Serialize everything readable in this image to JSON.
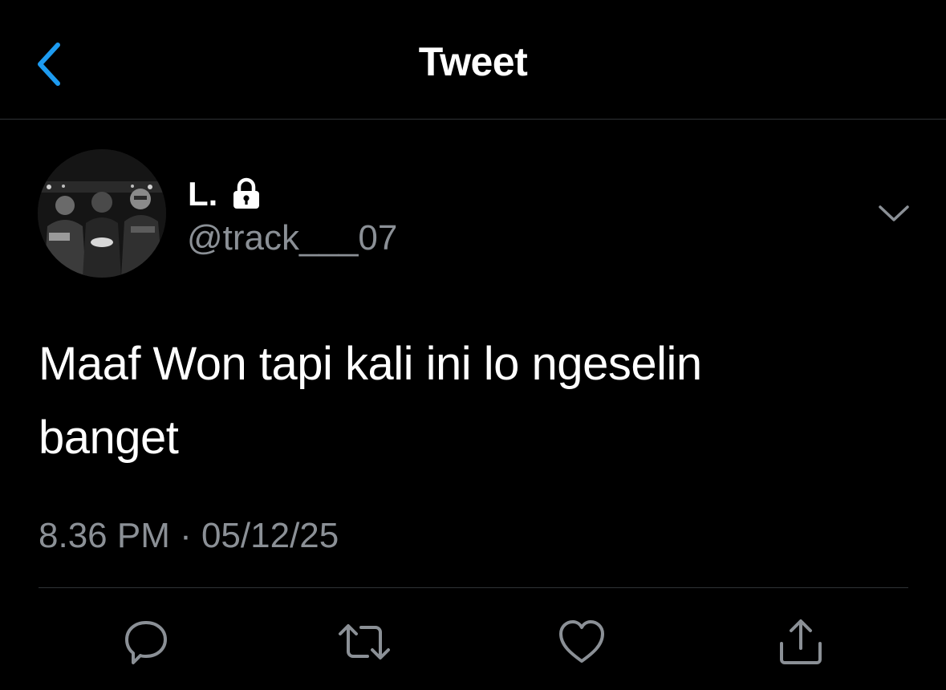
{
  "header": {
    "title": "Tweet",
    "back_icon": "chevron-left-icon",
    "accent_color": "#1d9bf0"
  },
  "tweet": {
    "author": {
      "display_name": "L.",
      "protected_icon": "lock-icon",
      "handle": "@track___07"
    },
    "menu_icon": "chevron-down-icon",
    "text_lines": [
      "Maaf Won tapi kali ini lo ngeselin",
      "banget"
    ],
    "timestamp": "8.36 PM · 05/12/25"
  },
  "actions": [
    {
      "icon": "reply-icon"
    },
    {
      "icon": "retweet-icon"
    },
    {
      "icon": "like-icon"
    },
    {
      "icon": "share-icon"
    }
  ],
  "colors": {
    "background": "#000000",
    "primary_text": "#ffffff",
    "secondary_text": "#8b9096",
    "divider": "#2f3336"
  }
}
